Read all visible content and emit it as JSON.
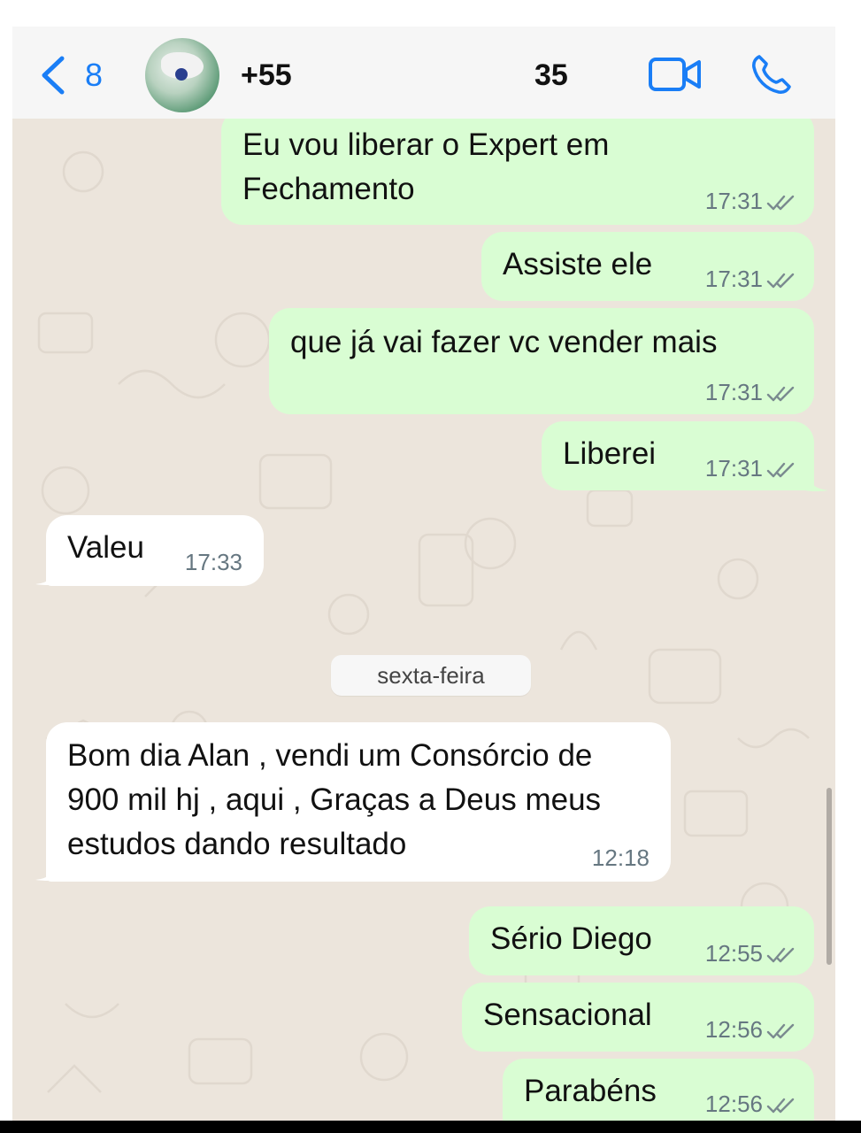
{
  "header": {
    "back_count": "8",
    "contact_name_prefix": "+55",
    "contact_name_suffix": "35",
    "icons": {
      "back": "chevron-left-icon",
      "video": "video-call-icon",
      "call": "phone-icon"
    },
    "accent_color": "#1a7ef6"
  },
  "chat": {
    "background_color": "#ece5dc",
    "outgoing_bubble_color": "#d9fdd3",
    "incoming_bubble_color": "#ffffff",
    "messages": [
      {
        "direction": "outgoing",
        "text": "Eu vou liberar o Expert em\nFechamento",
        "time": "17:31",
        "status": "read"
      },
      {
        "direction": "outgoing",
        "text": "Assiste ele",
        "time": "17:31",
        "status": "read"
      },
      {
        "direction": "outgoing",
        "text": "que já vai fazer vc vender mais",
        "time": "17:31",
        "status": "read"
      },
      {
        "direction": "outgoing",
        "text": "Liberei",
        "time": "17:31",
        "status": "read"
      },
      {
        "direction": "incoming",
        "text": "Valeu",
        "time": "17:33"
      },
      {
        "direction": "incoming",
        "text": "Bom dia Alan , vendi um Consórcio de\n900 mil hj , aqui , Graças a Deus meus\nestudos dando resultado",
        "time": "12:18"
      },
      {
        "direction": "outgoing",
        "text": "Sério Diego",
        "time": "12:55",
        "status": "read"
      },
      {
        "direction": "outgoing",
        "text": "Sensacional",
        "time": "12:56",
        "status": "read"
      },
      {
        "direction": "outgoing",
        "text": "Parabéns",
        "time": "12:56",
        "status": "read"
      }
    ],
    "date_separator": "sexta-feira"
  }
}
